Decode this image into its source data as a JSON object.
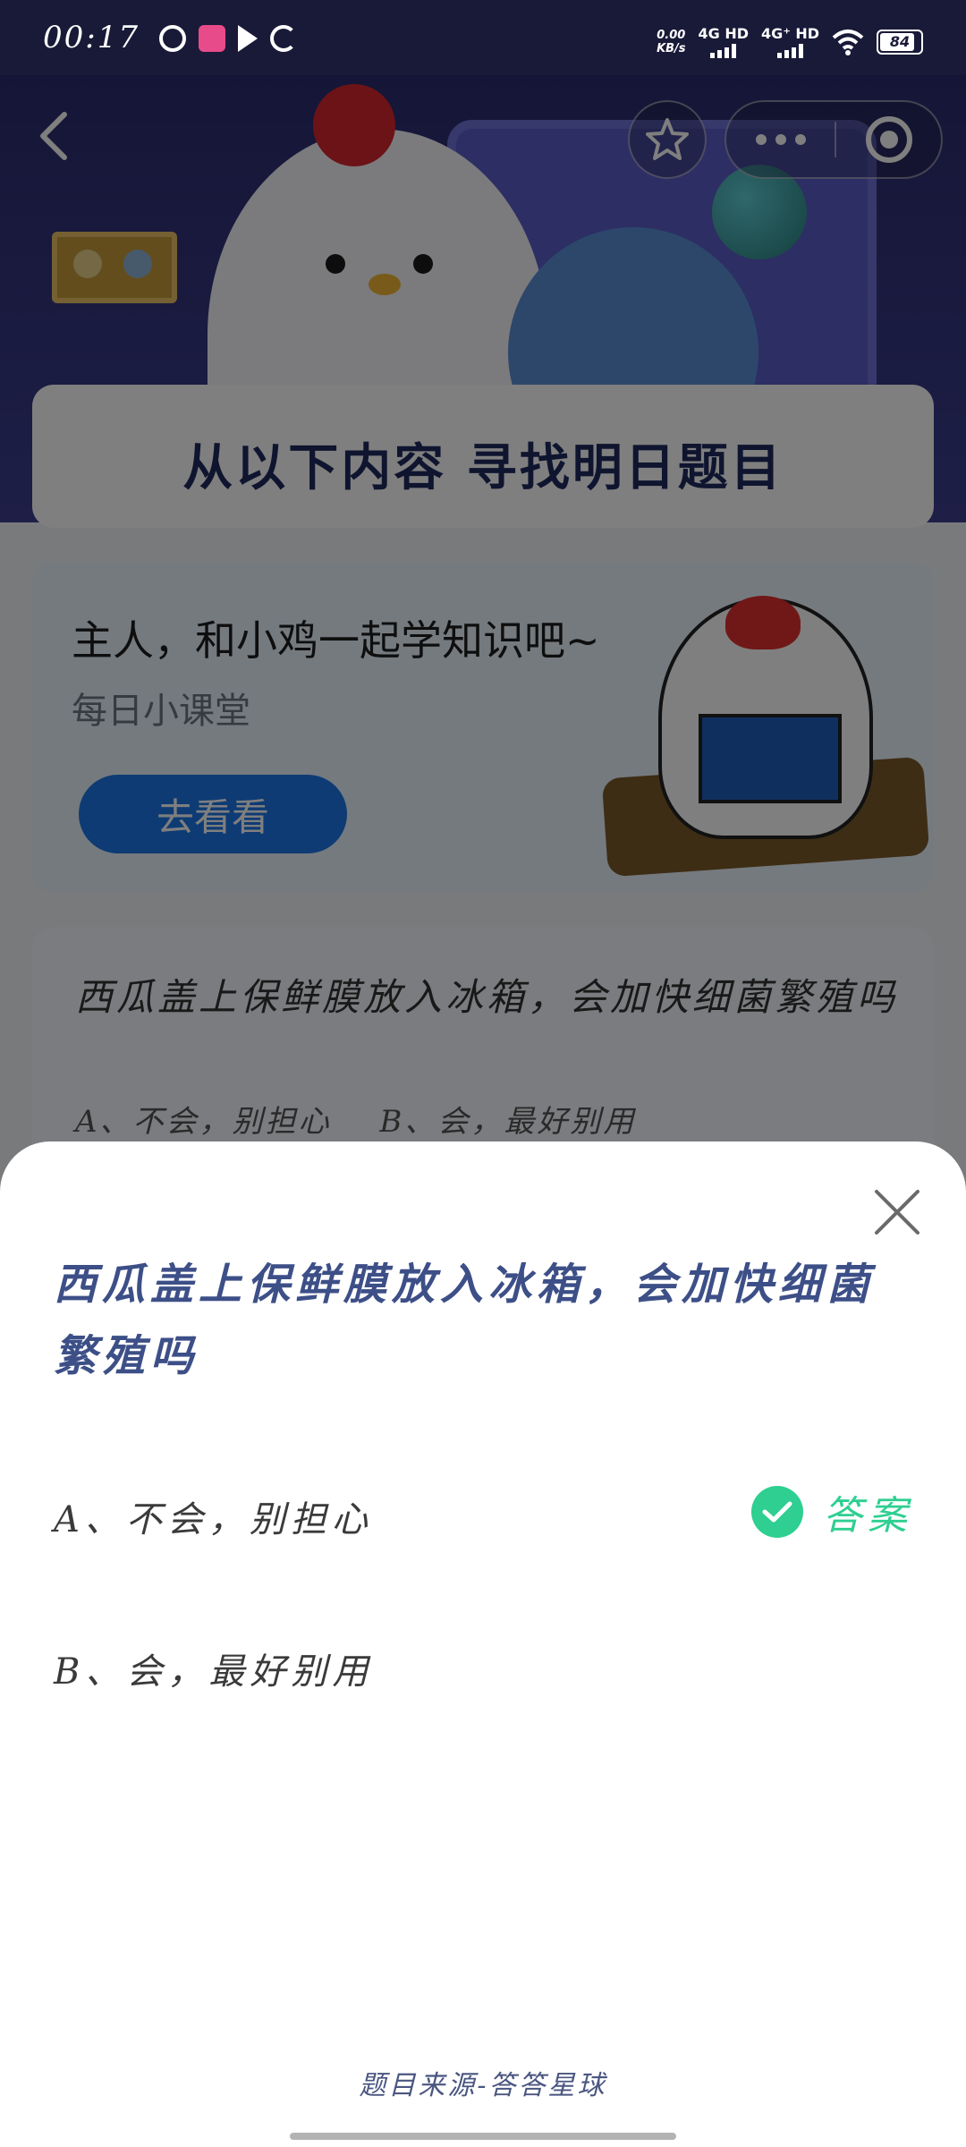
{
  "status_bar": {
    "time": "00:17",
    "net_speed_value": "0.00",
    "net_speed_unit": "KB/s",
    "sim1": "4G HD",
    "sim2": "4G⁺ HD",
    "battery": "84"
  },
  "nav": {
    "back_icon": "chevron-left-icon",
    "favorite_icon": "star-icon",
    "more_icon": "more-dots-icon",
    "close_icon": "target-icon"
  },
  "banner": {
    "title": "从以下内容  寻找明日题目"
  },
  "promo": {
    "title": "主人，和小鸡一起学知识吧~",
    "subtitle": "每日小课堂",
    "button_label": "去看看"
  },
  "question_card": {
    "question": "西瓜盖上保鲜膜放入冰箱，会加快细菌繁殖吗",
    "option_a": "A、不会，别担心",
    "option_b": "B、会，最好别用"
  },
  "sheet": {
    "question": "西瓜盖上保鲜膜放入冰箱，会加快细菌繁殖吗",
    "options": [
      {
        "label": "A、不会，别担心",
        "is_answer": true
      },
      {
        "label": "B、会，最好别用",
        "is_answer": false
      }
    ],
    "answer_label": "答案",
    "source": "题目来源-答答星球"
  },
  "colors": {
    "accent_green": "#2ecf91",
    "title_blue": "#3d4f87",
    "button_blue": "#1c76e8"
  }
}
